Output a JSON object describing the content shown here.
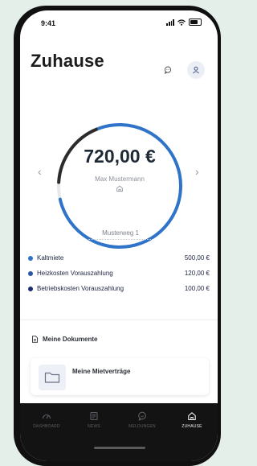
{
  "status": {
    "time": "9:41"
  },
  "header": {
    "title": "Zuhause",
    "chat_icon": "chat-bubble-icon",
    "user_icon": "user-icon"
  },
  "rent": {
    "amount": "720,00 €",
    "tenant": "Max Mustermann",
    "address": "Musterweg 1",
    "progress_fraction": 0.77
  },
  "costs": [
    {
      "label": "Kaltmiete",
      "value": "500,00 €",
      "color": "#2f74c9"
    },
    {
      "label": "Heizkosten Vorauszahlung",
      "value": "120,00 €",
      "color": "#2a55a8"
    },
    {
      "label": "Betriebskosten Vorauszahlung",
      "value": "100,00 €",
      "color": "#1c2f73"
    }
  ],
  "documents": {
    "heading": "Meine Dokumente",
    "items": [
      {
        "title": "Meine Mietverträge",
        "icon": "folder-icon"
      }
    ]
  },
  "tabbar": {
    "items": [
      {
        "label": "DASHBOARD",
        "icon": "dashboard-icon"
      },
      {
        "label": "NEWS",
        "icon": "news-icon"
      },
      {
        "label": "MELDUNGEN",
        "icon": "chat-icon"
      },
      {
        "label": "ZUHAUSE",
        "icon": "home-icon",
        "active": true
      }
    ]
  },
  "colors": {
    "accent": "#2f74c9",
    "ring_dark": "#2b2b2b",
    "ring_track": "#e6e8ec",
    "background": "#e3efe8"
  }
}
